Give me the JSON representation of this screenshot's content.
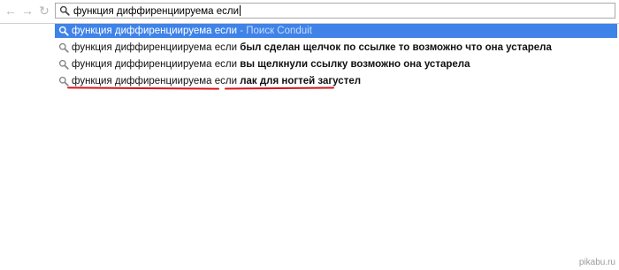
{
  "toolbar": {
    "back_icon": "back-arrow-icon",
    "forward_icon": "forward-arrow-icon",
    "reload_icon": "reload-icon"
  },
  "omnibox": {
    "icon": "search-icon",
    "value": "функция диффиренциируема если"
  },
  "suggestions": [
    {
      "prefix": "функция диффиренциируема если",
      "completion": "",
      "hint": " - Поиск Conduit",
      "selected": true
    },
    {
      "prefix": "функция диффиренциируема если",
      "completion": "был сделан щелчок по ссылке то возможно что она устарела",
      "hint": "",
      "selected": false
    },
    {
      "prefix": "функция диффиренциируема если",
      "completion": "вы щелкнули ссылку возможно она устарела",
      "hint": "",
      "selected": false
    },
    {
      "prefix": "функция диффиренциируема если",
      "completion": "лак для ногтей загустел",
      "hint": "",
      "selected": false,
      "underlined": true
    }
  ],
  "colors": {
    "selected_row": "#3f83e8",
    "annotation_underline": "#d9141d"
  },
  "watermark": "pikabu.ru"
}
